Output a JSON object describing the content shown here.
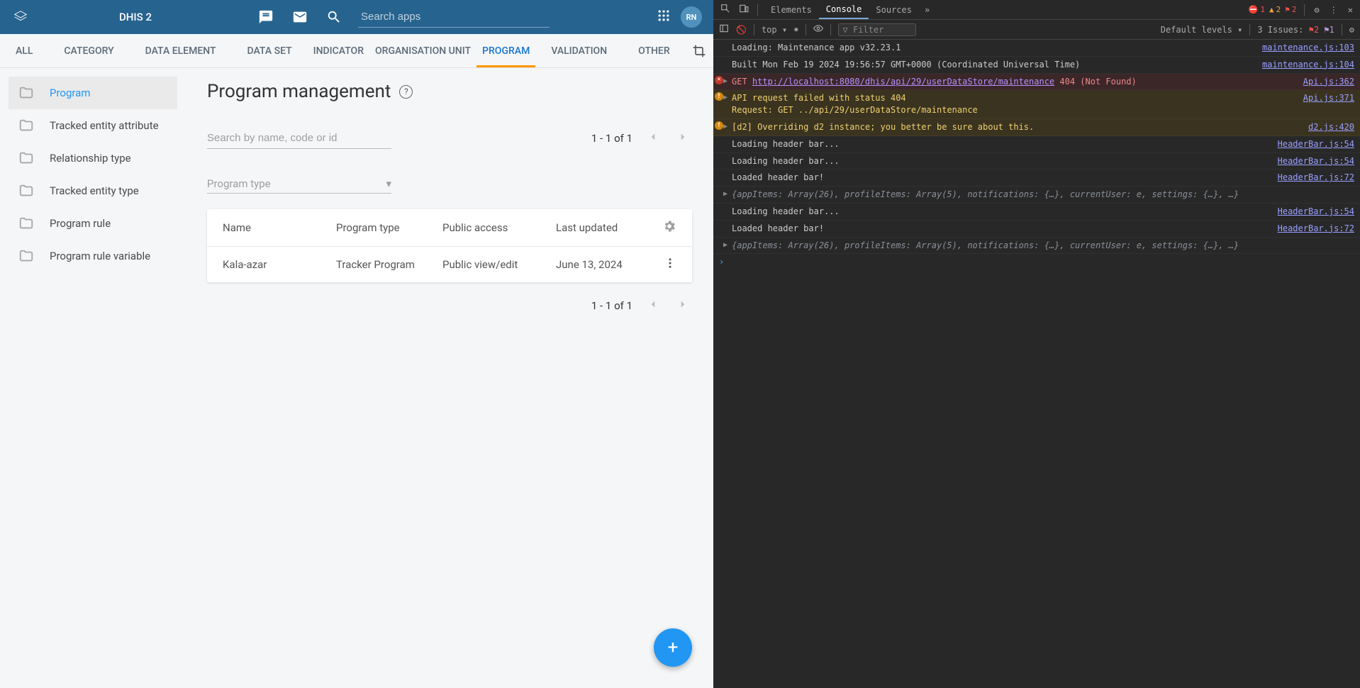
{
  "header": {
    "title": "DHIS 2",
    "search_placeholder": "Search apps",
    "avatar_initials": "RN"
  },
  "tabs": {
    "items": [
      "ALL",
      "CATEGORY",
      "DATA ELEMENT",
      "DATA SET",
      "INDICATOR",
      "ORGANISATION UNIT",
      "PROGRAM",
      "VALIDATION",
      "OTHER"
    ],
    "active": "PROGRAM"
  },
  "sidebar": {
    "items": [
      {
        "label": "Program",
        "active": true
      },
      {
        "label": "Tracked entity attribute",
        "active": false
      },
      {
        "label": "Relationship type",
        "active": false
      },
      {
        "label": "Tracked entity type",
        "active": false
      },
      {
        "label": "Program rule",
        "active": false
      },
      {
        "label": "Program rule variable",
        "active": false
      }
    ]
  },
  "main": {
    "heading": "Program management",
    "search_placeholder": "Search by name, code or id",
    "pager_text": "1 - 1 of 1",
    "filter_label": "Program type",
    "table": {
      "columns": [
        "Name",
        "Program type",
        "Public access",
        "Last updated"
      ],
      "rows": [
        {
          "name": "Kala-azar",
          "type": "Tracker Program",
          "access": "Public view/edit",
          "updated": "June 13, 2024"
        }
      ]
    }
  },
  "devtools": {
    "tabs": [
      "Elements",
      "Console",
      "Sources"
    ],
    "active_tab": "Console",
    "err_count": "1",
    "warn_count": "2",
    "info_count": "2",
    "context": "top",
    "filter_placeholder": "Filter",
    "levels": "Default levels",
    "issues_label": "3 Issues:",
    "issues_err": "2",
    "issues_info": "1",
    "logs": [
      {
        "kind": "plain",
        "msg": "Loading: Maintenance app v32.23.1",
        "src": "maintenance.js:103"
      },
      {
        "kind": "plain",
        "msg": "Built Mon Feb 19 2024 19:56:57 GMT+0000 (Coordinated Universal Time)",
        "src": "maintenance.js:104"
      },
      {
        "kind": "err",
        "tri": true,
        "msg_pre": "GET ",
        "url": "http://localhost:8080/dhis/api/29/userDataStore/maintenance",
        "msg_post": " 404 (Not Found)",
        "src": "Api.js:362"
      },
      {
        "kind": "warn",
        "tri": true,
        "msg": "API request failed with status 404\nRequest: GET ../api/29/userDataStore/maintenance",
        "src": "Api.js:371"
      },
      {
        "kind": "warn",
        "tri": true,
        "msg": "[d2] Overriding d2 instance; you better be sure about this.",
        "src": "d2.js:420"
      },
      {
        "kind": "plain",
        "msg": "Loading header bar...",
        "src": "HeaderBar.js:54"
      },
      {
        "kind": "plain",
        "msg": "Loading header bar...",
        "src": "HeaderBar.js:54"
      },
      {
        "kind": "plain",
        "msg": "Loaded header bar!",
        "src": "HeaderBar.js:72"
      },
      {
        "kind": "obj",
        "tri": true,
        "msg": "{appItems: Array(26), profileItems: Array(5), notifications: {…}, currentUser: e, settings: {…}, …}",
        "src": ""
      },
      {
        "kind": "plain",
        "msg": "Loading header bar...",
        "src": "HeaderBar.js:54"
      },
      {
        "kind": "plain",
        "msg": "Loaded header bar!",
        "src": "HeaderBar.js:72"
      },
      {
        "kind": "obj",
        "tri": true,
        "msg": "{appItems: Array(26), profileItems: Array(5), notifications: {…}, currentUser: e, settings: {…}, …}",
        "src": ""
      }
    ]
  }
}
